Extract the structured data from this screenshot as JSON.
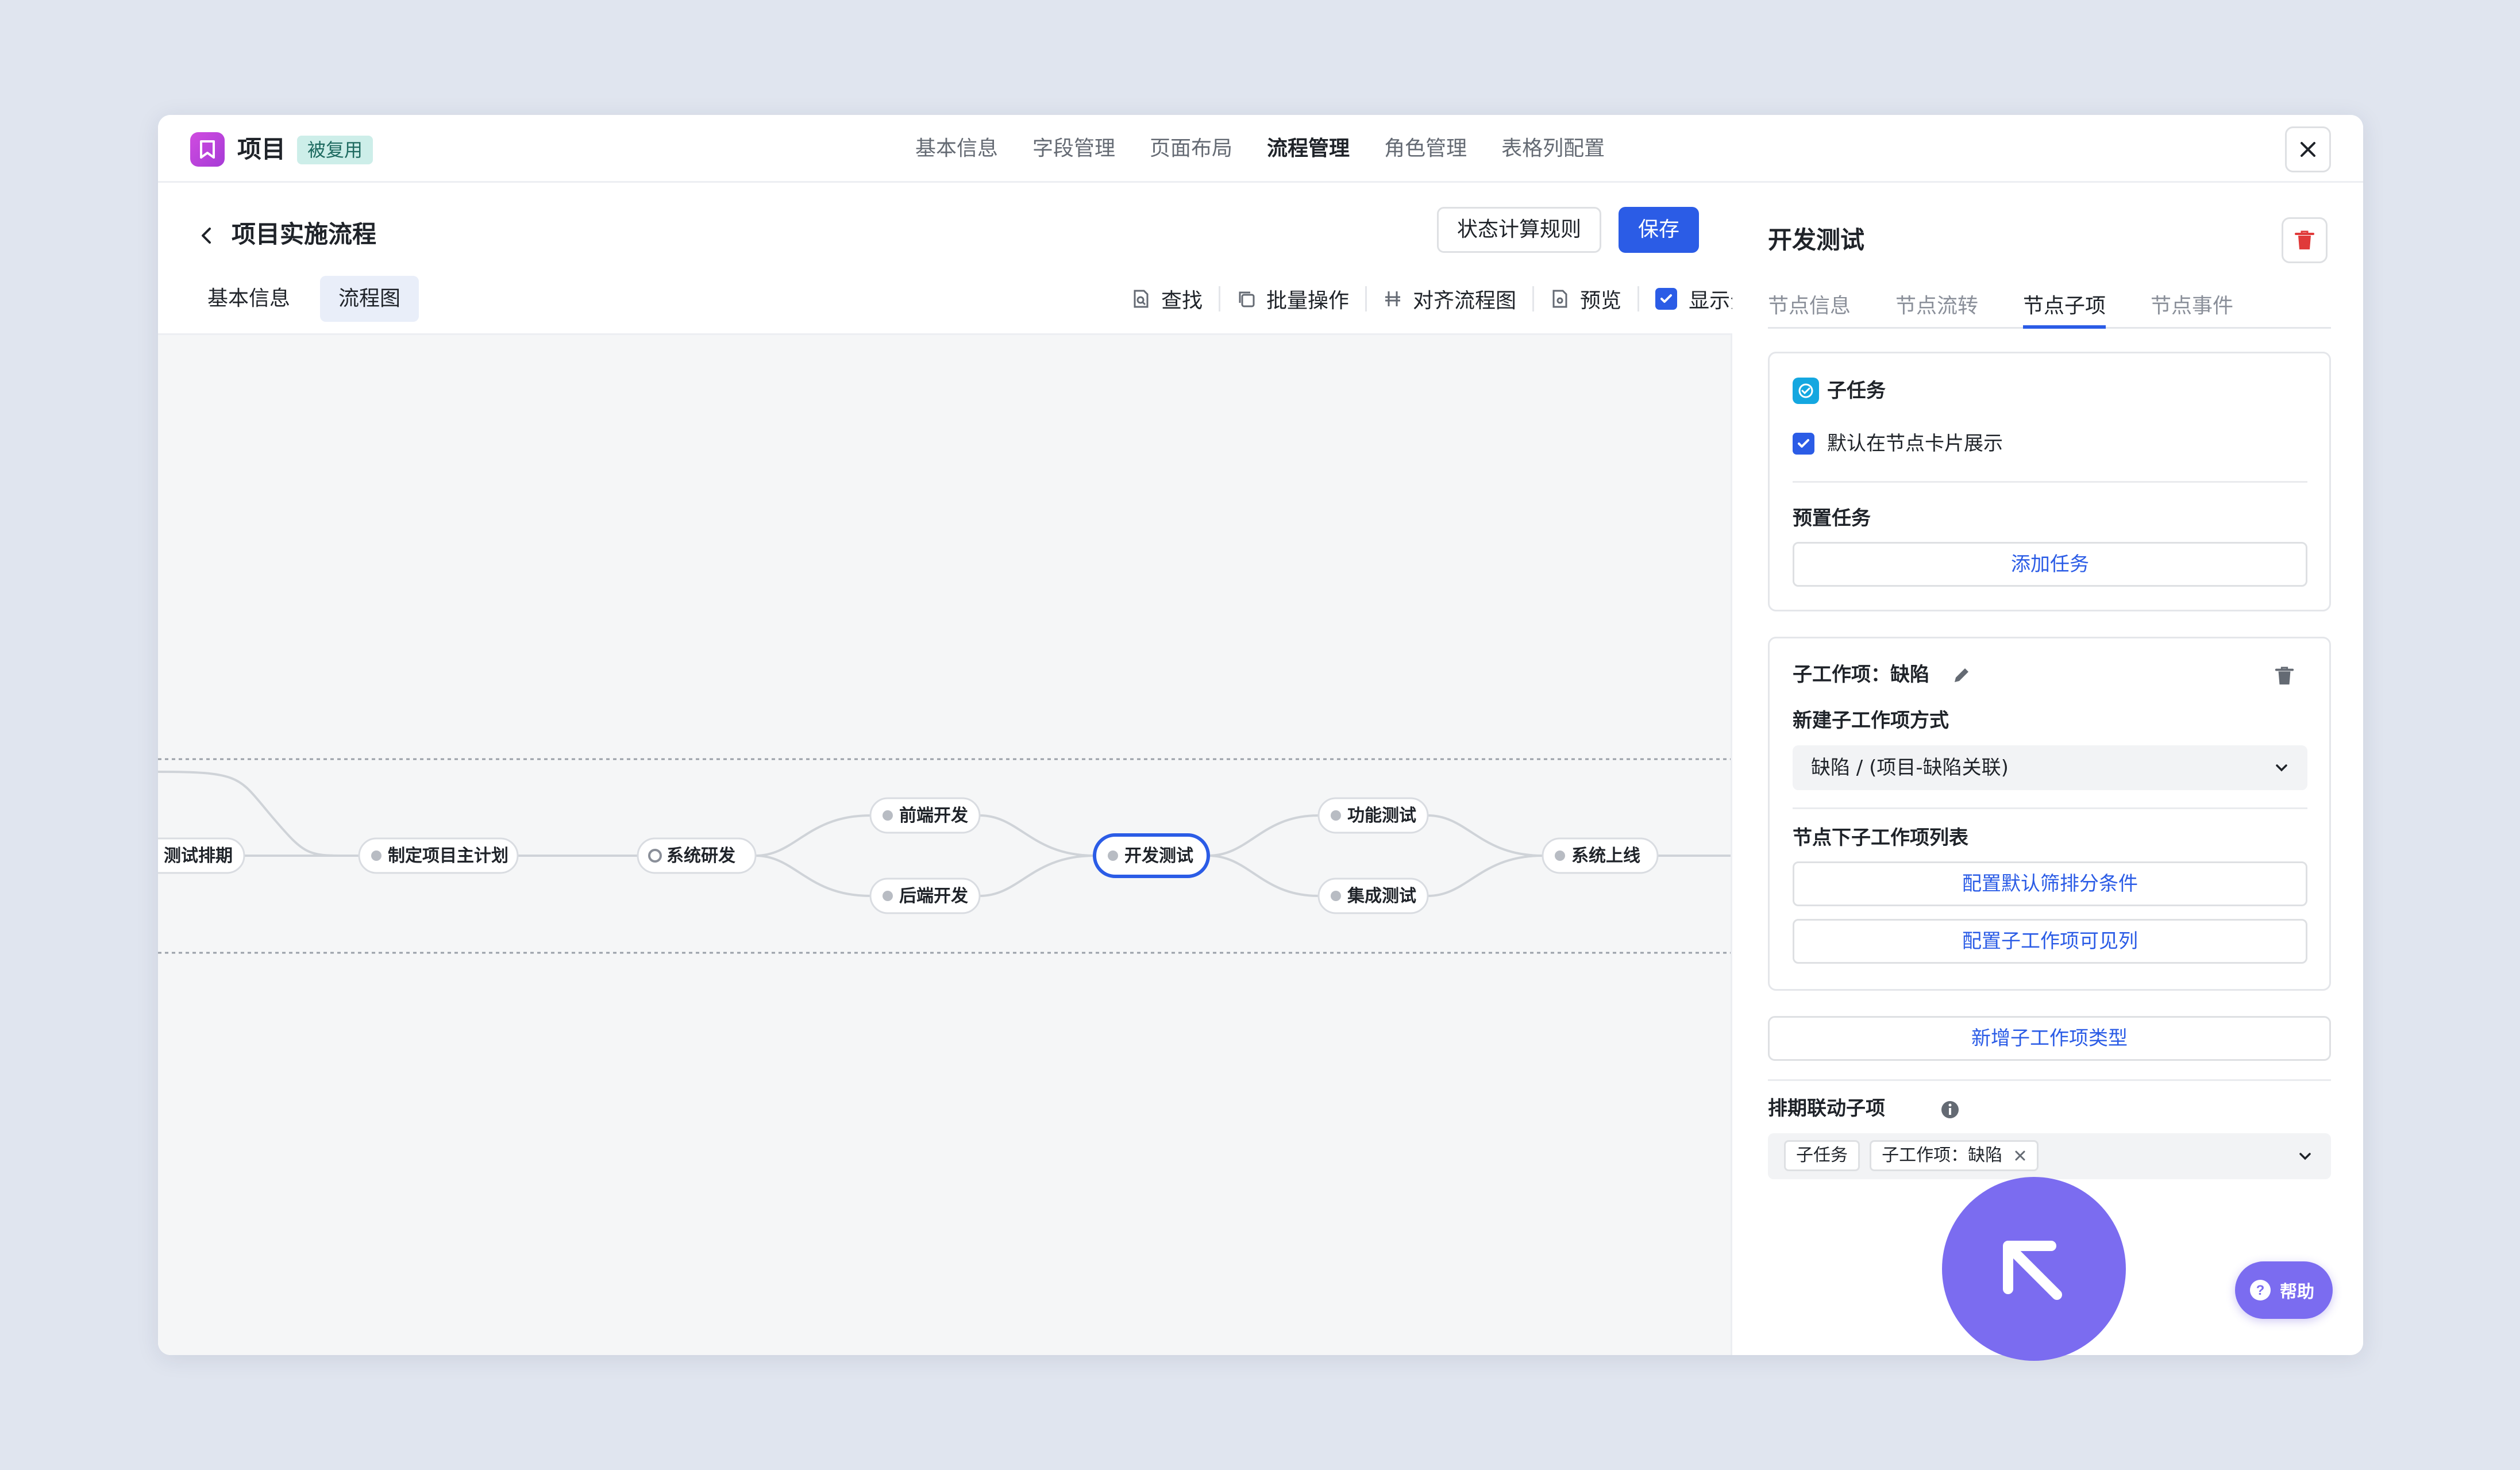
{
  "header": {
    "app_title": "项目",
    "badge": "被复用",
    "tabs": [
      "基本信息",
      "字段管理",
      "页面布局",
      "流程管理",
      "角色管理",
      "表格列配置"
    ],
    "active_tab": "流程管理"
  },
  "flow": {
    "title": "项目实施流程",
    "status_rule_button": "状态计算规则",
    "save_button": "保存",
    "subtabs": [
      "基本信息",
      "流程图"
    ],
    "active_subtab": "流程图",
    "toolbar": {
      "find": "查找",
      "batch": "批量操作",
      "align": "对齐流程图",
      "preview": "预览",
      "show_outline": "显示分组轮廓"
    },
    "nodes": {
      "n1": "测试排期",
      "n2": "制定项目主计划",
      "n3": "系统研发",
      "n4": "前端开发",
      "n5": "后端开发",
      "n6": "开发测试",
      "n7": "功能测试",
      "n8": "集成测试",
      "n9": "系统上线"
    }
  },
  "panel": {
    "title": "开发测试",
    "tabs": [
      "节点信息",
      "节点流转",
      "节点子项",
      "节点事件"
    ],
    "active_tab": "节点子项",
    "subtask": {
      "label": "子任务",
      "default_show": "默认在节点卡片展示",
      "preset_label": "预置任务",
      "add_task": "添加任务"
    },
    "subwork": {
      "label": "子工作项：缺陷",
      "create_mode_label": "新建子工作项方式",
      "create_mode_value": "缺陷 / (项目-缺陷关联)",
      "list_label": "节点下子工作项列表",
      "config_filter": "配置默认筛排分条件",
      "config_columns": "配置子工作项可见列"
    },
    "add_type": "新增子工作项类型",
    "schedule": {
      "label": "排期联动子项",
      "tags": [
        "子任务",
        "子工作项：缺陷"
      ]
    }
  },
  "help": "帮助",
  "colors": {
    "primary": "#2b5ce6",
    "badge_bg": "#cdeee9",
    "delete": "#e03a3a",
    "cursor": "#7b6cf0"
  }
}
